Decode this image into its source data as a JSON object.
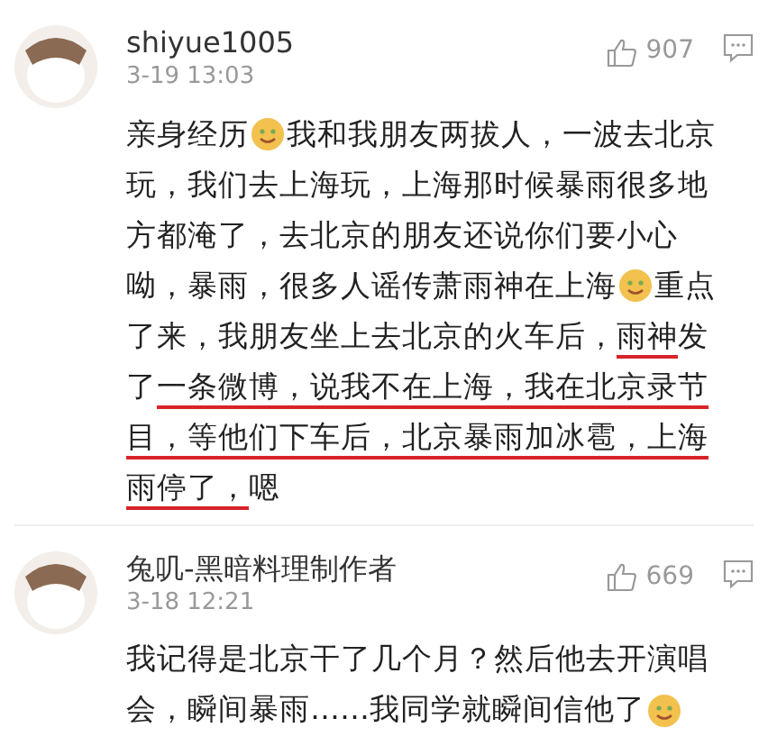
{
  "comments": [
    {
      "username": "shiyue1005",
      "time": "3-19 13:03",
      "likes": "907",
      "lines": [
        [
          {
            "kind": "text",
            "text": "亲身经历",
            "underlined": false
          },
          {
            "kind": "emoji"
          },
          {
            "kind": "text",
            "text": "我和我朋友两拔人，一波去北京",
            "underlined": false
          }
        ],
        [
          {
            "kind": "text",
            "text": "玩，我们去上海玩，上海那时候暴雨很多地",
            "underlined": false
          }
        ],
        [
          {
            "kind": "text",
            "text": "方都淹了，去北京的朋友还说你们要小心",
            "underlined": false
          }
        ],
        [
          {
            "kind": "text",
            "text": "呦，暴雨，很多人谣传萧雨神在上海",
            "underlined": false
          },
          {
            "kind": "emoji"
          },
          {
            "kind": "text",
            "text": "重点",
            "underlined": false
          }
        ],
        [
          {
            "kind": "text",
            "text": "了来，我朋友坐上去北京的火车后，",
            "underlined": false
          },
          {
            "kind": "text",
            "text": "雨神",
            "underlined": true
          },
          {
            "kind": "text",
            "text": "发",
            "underlined": false
          }
        ],
        [
          {
            "kind": "text",
            "text": "了",
            "underlined": false
          },
          {
            "kind": "text",
            "text": "一条微博，说我不在上海，我在北京录节",
            "underlined": true
          }
        ],
        [
          {
            "kind": "text",
            "text": "目，等他们下车后，北京暴雨加冰雹，上海",
            "underlined": true
          }
        ],
        [
          {
            "kind": "text",
            "text": "雨停了，",
            "underlined": true
          },
          {
            "kind": "text",
            "text": "嗯",
            "underlined": false
          }
        ]
      ]
    },
    {
      "username": "兔叽-黑暗料理制作者",
      "time": "3-18 12:21",
      "likes": "669",
      "lines": [
        [
          {
            "kind": "text",
            "text": "我记得是北京干了几个月？然后他去开演唱",
            "underlined": false
          }
        ],
        [
          {
            "kind": "text",
            "text": "会，瞬间暴雨……我同学就瞬间信他了",
            "underlined": false
          },
          {
            "kind": "emoji"
          }
        ]
      ]
    }
  ]
}
